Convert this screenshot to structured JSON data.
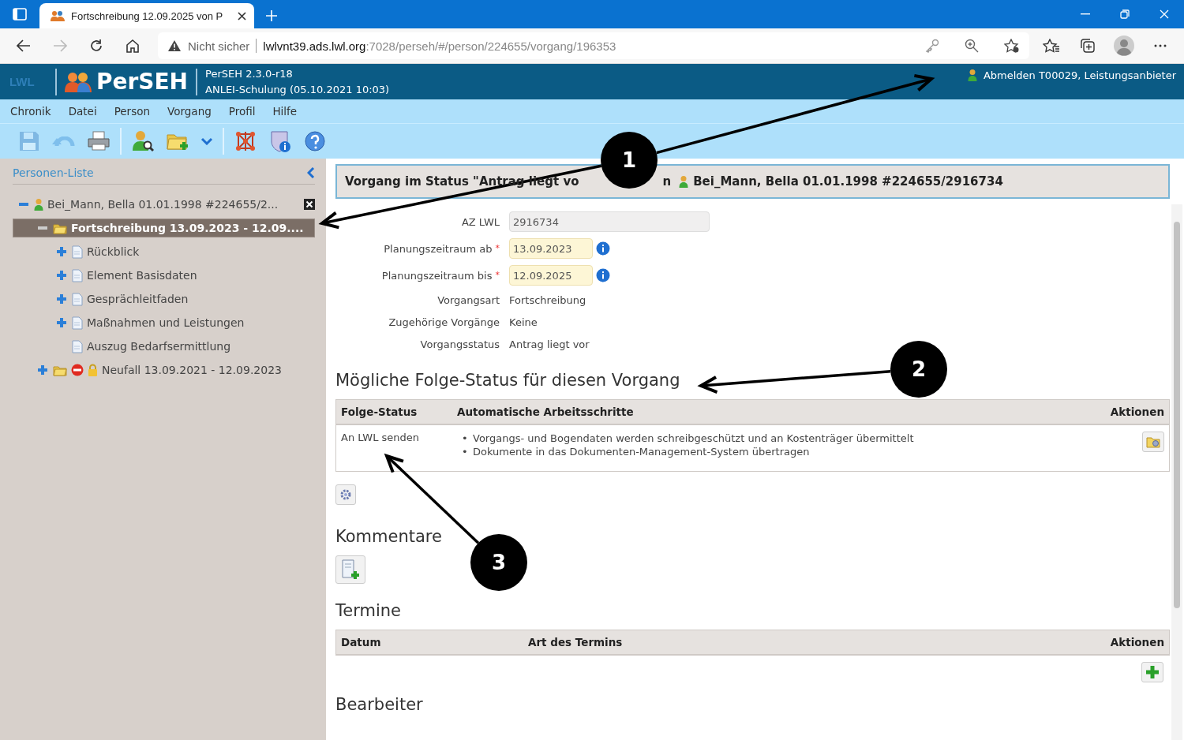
{
  "browser": {
    "tab_title": "Fortschreibung 12.09.2025 von P",
    "security_label": "Nicht sicher",
    "url_host": "lwlvnt39.ads.lwl.org",
    "url_path": ":7028/perseh/#/person/224655/vorgang/196353"
  },
  "app_header": {
    "logo": "LWL",
    "product": "PerSEH",
    "version": "PerSEH 2.3.0-r18",
    "session": "ANLEI-Schulung (05.10.2021 10:03)",
    "logout": "Abmelden T00029, Leistungsanbieter"
  },
  "menu": [
    "Chronik",
    "Datei",
    "Person",
    "Vorgang",
    "Profil",
    "Hilfe"
  ],
  "toolbar": [
    [
      {
        "kind": "save",
        "disabled": true
      },
      {
        "kind": "undo",
        "disabled": true
      },
      {
        "kind": "print",
        "disabled": false
      }
    ],
    [
      {
        "kind": "person-search",
        "disabled": false
      },
      {
        "kind": "folder-add",
        "disabled": false
      },
      {
        "kind": "dropdown",
        "disabled": false
      }
    ],
    [
      {
        "kind": "network",
        "disabled": false
      },
      {
        "kind": "shield-info",
        "disabled": false
      },
      {
        "kind": "help",
        "disabled": false
      }
    ]
  ],
  "sidebar": {
    "title": "Personen-Liste",
    "tree": [
      {
        "label": "Bei_Mann, Bella 01.01.1998 #224655/2...",
        "kind": "person",
        "expanded": true,
        "selected": false,
        "closable": true,
        "children": [
          {
            "label": "Fortschreibung 13.09.2023 - 12.09....",
            "kind": "folder",
            "expanded": true,
            "selected": true,
            "stopped": false,
            "locked": false,
            "children": [
              {
                "label": "Rückblick",
                "kind": "document",
                "expanded": false,
                "selected": false
              },
              {
                "label": "Element Basisdaten",
                "kind": "document",
                "expanded": false,
                "selected": false
              },
              {
                "label": "Gesprächleitfaden",
                "kind": "document",
                "expanded": false,
                "selected": false
              },
              {
                "label": "Maßnahmen und Leistungen",
                "kind": "document",
                "expanded": false,
                "selected": false
              },
              {
                "label": "Auszug Bedarfsermittlung",
                "kind": "document",
                "selected": false
              }
            ]
          },
          {
            "label": "Neufall 13.09.2021 - 12.09.2023",
            "kind": "folder",
            "expanded": false,
            "selected": false,
            "stopped": true,
            "locked": true
          }
        ]
      }
    ]
  },
  "header": {
    "status_text": "Vorgang im Status \"Antrag liegt vo",
    "status_tail": "n",
    "person": "Bei_Mann, Bella 01.01.1998 #224655/2916734"
  },
  "required_mark": "*",
  "fields": [
    {
      "label": "AZ LWL",
      "kind": "readonly",
      "value": "2916734",
      "required": false
    },
    {
      "label": "Planungszeitraum ab",
      "kind": "date",
      "value": "13.09.2023",
      "required": true
    },
    {
      "label": "Planungszeitraum bis",
      "kind": "date",
      "value": "12.09.2025",
      "required": true
    },
    {
      "label": "Vorgangsart",
      "kind": "text",
      "value": "Fortschreibung",
      "required": false
    },
    {
      "label": "Zugehörige Vorgänge",
      "kind": "text",
      "value": "Keine",
      "required": false
    },
    {
      "label": "Vorgangsstatus",
      "kind": "text",
      "value": "Antrag liegt vor",
      "required": false
    }
  ],
  "next_status": {
    "title": "Mögliche Folge-Status für diesen Vorgang",
    "columns": [
      "Folge-Status",
      "Automatische Arbeitsschritte",
      "Aktionen"
    ],
    "bullet": "•",
    "rows": [
      {
        "status": "An LWL senden",
        "steps": [
          "Vorgangs- und Bogendaten werden schreibgeschützt und an Kostenträger übermittelt",
          "Dokumente in das Dokumenten-Management-System übertragen"
        ]
      }
    ]
  },
  "comments": {
    "title": "Kommentare"
  },
  "appointments": {
    "title": "Termine",
    "columns": [
      "Datum",
      "Art des Termins",
      "Aktionen"
    ]
  },
  "editors": {
    "title": "Bearbeiter"
  },
  "annotations": [
    {
      "label": "1"
    },
    {
      "label": "2"
    },
    {
      "label": "3"
    }
  ]
}
